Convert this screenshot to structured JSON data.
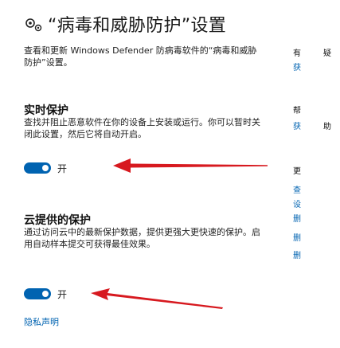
{
  "page": {
    "title": "“病毒和威胁防护”设置",
    "description": "查看和更新 Windows Defender 防病毒软件的“病毒和威胁防护”设置。"
  },
  "realtime": {
    "heading": "实时保护",
    "description": "查找并阻止恶意软件在你的设备上安装或运行。你可以暂时关闭此设置，然后它将自动开启。",
    "toggle_state": "开"
  },
  "cloud": {
    "heading": "云提供的保护",
    "description": "通过访问云中的最新保护数据，提供更强大更快速的保护。启用自动样本提交可获得最佳效果。",
    "toggle_state": "开"
  },
  "privacy_link": "隐私声明",
  "sidebar": {
    "section1": [
      "有",
      "获"
    ],
    "section1_tail": "疑",
    "section2_title": "帮",
    "section2_link": "获",
    "section2_tail": "助",
    "section3_title": "更",
    "section3_links": [
      "查",
      "设",
      "删",
      "删",
      "删"
    ]
  },
  "colors": {
    "accent": "#0063b1",
    "arrow": "#d7191f"
  }
}
